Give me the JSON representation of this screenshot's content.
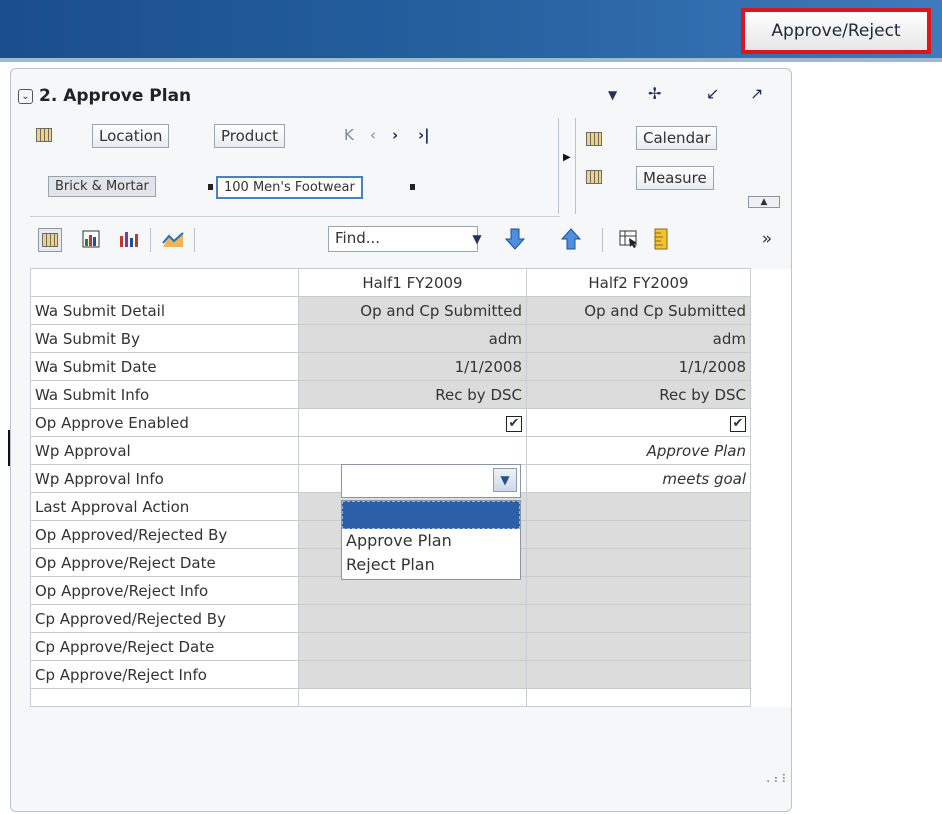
{
  "topbar": {
    "approve_reject_label": "Approve/Reject"
  },
  "panel": {
    "title": "2. Approve Plan",
    "icons": [
      "chevron-down-icon",
      "move-icon",
      "minimize-icon",
      "maximize-icon"
    ]
  },
  "pivot": {
    "row_tiles": [
      "Location",
      "Product"
    ],
    "page_tiles": [
      "Brick & Mortar",
      "100 Men's Footwear"
    ],
    "column_tiles": [
      "Calendar",
      "Measure"
    ],
    "nav_icons": [
      "first-icon",
      "prev-icon",
      "next-icon",
      "last-icon"
    ]
  },
  "toolbar": {
    "find_placeholder": "Find...",
    "more_label": "»"
  },
  "grid": {
    "columns": [
      "Half1 FY2009",
      "Half2 FY2009"
    ],
    "rows": [
      {
        "label": "Wa Submit Detail",
        "v1": "Op and Cp Submitted",
        "v2": "Op and Cp Submitted"
      },
      {
        "label": "Wa Submit By",
        "v1": "adm",
        "v2": "adm"
      },
      {
        "label": "Wa Submit Date",
        "v1": "1/1/2008",
        "v2": "1/1/2008"
      },
      {
        "label": "Wa Submit Info",
        "v1": "Rec by DSC",
        "v2": "Rec by DSC"
      },
      {
        "label": "Op Approve Enabled",
        "v1": "✔",
        "v2": "✔"
      },
      {
        "label": "Wp Approval",
        "v1": "",
        "v2": "Approve Plan"
      },
      {
        "label": "Wp Approval Info",
        "v1": "",
        "v2": "meets goal"
      },
      {
        "label": "Last Approval Action",
        "v1": "",
        "v2": ""
      },
      {
        "label": "Op Approved/Rejected By",
        "v1": "",
        "v2": ""
      },
      {
        "label": "Op Approve/Reject Date",
        "v1": "",
        "v2": ""
      },
      {
        "label": "Op Approve/Reject Info",
        "v1": "",
        "v2": ""
      },
      {
        "label": "Cp Approved/Rejected By",
        "v1": "",
        "v2": ""
      },
      {
        "label": "Cp Approve/Reject Date",
        "v1": "",
        "v2": ""
      },
      {
        "label": "Cp Approve/Reject Info",
        "v1": "",
        "v2": ""
      }
    ]
  },
  "dropdown": {
    "selected": "",
    "options": [
      "Approve Plan",
      "Reject Plan"
    ]
  }
}
